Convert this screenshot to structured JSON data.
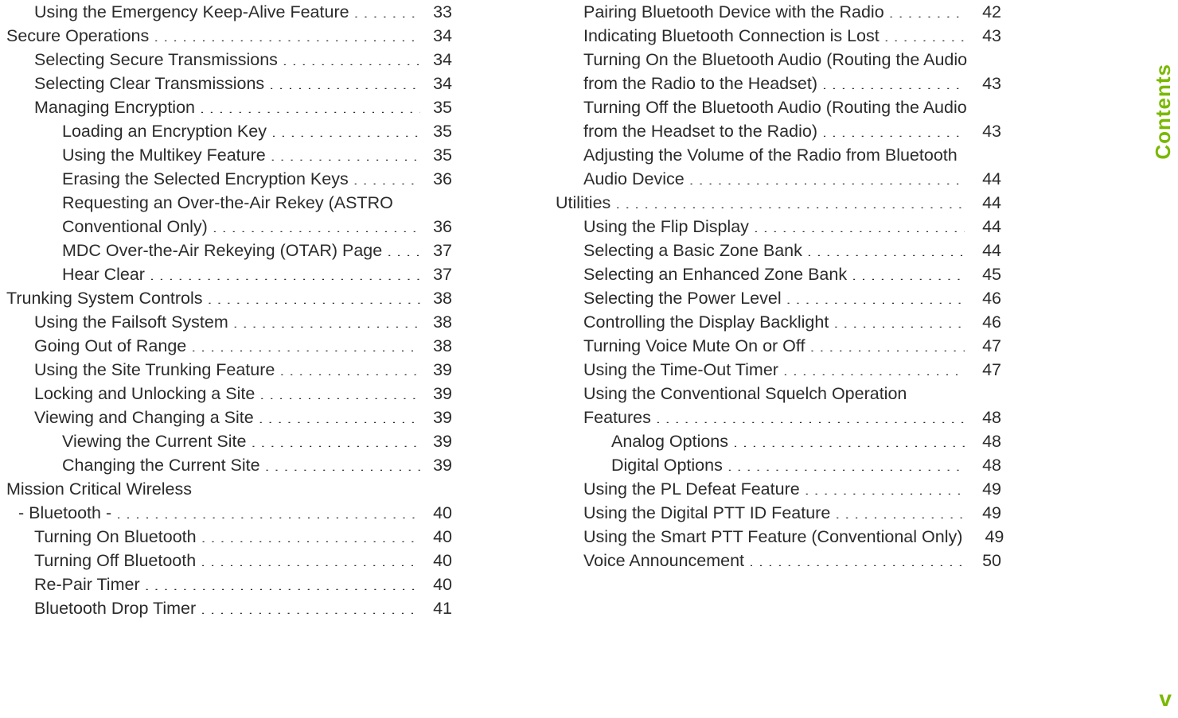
{
  "sideTab": {
    "label": "Contents"
  },
  "pageNumber": "v",
  "left": [
    {
      "kind": "entry",
      "level": 1,
      "title": "Using the Emergency Keep-Alive Feature",
      "page": "33"
    },
    {
      "kind": "entry",
      "level": 0,
      "title": "Secure Operations",
      "page": "34"
    },
    {
      "kind": "entry",
      "level": 1,
      "title": "Selecting Secure Transmissions",
      "page": "34"
    },
    {
      "kind": "entry",
      "level": 1,
      "title": "Selecting Clear Transmissions",
      "page": "34"
    },
    {
      "kind": "entry",
      "level": 1,
      "title": "Managing Encryption",
      "page": "35"
    },
    {
      "kind": "entry",
      "level": 2,
      "title": "Loading an Encryption Key",
      "page": "35"
    },
    {
      "kind": "entry",
      "level": 2,
      "title": "Using the Multikey Feature",
      "page": "35"
    },
    {
      "kind": "entry",
      "level": 2,
      "title": "Erasing the Selected Encryption Keys",
      "page": "36"
    },
    {
      "kind": "wrap",
      "level": 2,
      "title": "Requesting an Over-the-Air Rekey (ASTRO"
    },
    {
      "kind": "entry",
      "level": 2,
      "title": "Conventional Only)",
      "page": "36"
    },
    {
      "kind": "entry",
      "level": 2,
      "title": "MDC Over-the-Air Rekeying (OTAR) Page",
      "page": "37"
    },
    {
      "kind": "entry",
      "level": 2,
      "title": "Hear Clear",
      "page": "37"
    },
    {
      "kind": "entry",
      "level": 0,
      "title": "Trunking System Controls",
      "page": "38"
    },
    {
      "kind": "entry",
      "level": 1,
      "title": "Using the Failsoft System",
      "page": "38"
    },
    {
      "kind": "entry",
      "level": 1,
      "title": "Going Out of Range",
      "page": "38"
    },
    {
      "kind": "entry",
      "level": 1,
      "title": "Using the Site Trunking Feature",
      "page": "39"
    },
    {
      "kind": "entry",
      "level": 1,
      "title": "Locking and Unlocking a Site",
      "page": "39"
    },
    {
      "kind": "entry",
      "level": 1,
      "title": "Viewing and Changing a Site",
      "page": "39"
    },
    {
      "kind": "entry",
      "level": 2,
      "title": "Viewing the Current Site",
      "page": "39"
    },
    {
      "kind": "entry",
      "level": 2,
      "title": "Changing the Current Site",
      "page": "39"
    },
    {
      "kind": "wrap",
      "level": 0,
      "title": "Mission Critical Wireless"
    },
    {
      "kind": "entry",
      "level": 0,
      "title": " - Bluetooth -",
      "page": "40",
      "extraPad": "15px"
    },
    {
      "kind": "entry",
      "level": 1,
      "title": "Turning On Bluetooth",
      "page": "40"
    },
    {
      "kind": "entry",
      "level": 1,
      "title": "Turning Off Bluetooth",
      "page": "40"
    },
    {
      "kind": "entry",
      "level": 1,
      "title": "Re-Pair Timer",
      "page": "40"
    },
    {
      "kind": "entry",
      "level": 1,
      "title": "Bluetooth Drop Timer",
      "page": "41"
    }
  ],
  "right": [
    {
      "kind": "entry",
      "level": 1,
      "title": "Pairing Bluetooth Device with the Radio",
      "page": "42"
    },
    {
      "kind": "entry",
      "level": 1,
      "title": "Indicating Bluetooth Connection is Lost",
      "page": "43"
    },
    {
      "kind": "wrap",
      "level": 1,
      "title": "Turning On the Bluetooth Audio (Routing the Audio"
    },
    {
      "kind": "entry",
      "level": 1,
      "title": "from the Radio to the Headset)",
      "page": "43"
    },
    {
      "kind": "wrap",
      "level": 1,
      "title": "Turning Off the Bluetooth Audio (Routing the Audio"
    },
    {
      "kind": "entry",
      "level": 1,
      "title": "from the Headset to the Radio)",
      "page": "43"
    },
    {
      "kind": "wrap",
      "level": 1,
      "title": "Adjusting the Volume of the Radio from Bluetooth"
    },
    {
      "kind": "entry",
      "level": 1,
      "title": "Audio Device",
      "page": "44"
    },
    {
      "kind": "entry",
      "level": 0,
      "title": "Utilities",
      "page": "44"
    },
    {
      "kind": "entry",
      "level": 1,
      "title": "Using the Flip Display",
      "page": "44"
    },
    {
      "kind": "entry",
      "level": 1,
      "title": "Selecting a Basic Zone Bank",
      "page": "44"
    },
    {
      "kind": "entry",
      "level": 1,
      "title": "Selecting an Enhanced Zone Bank",
      "page": "45"
    },
    {
      "kind": "entry",
      "level": 1,
      "title": "Selecting the Power Level",
      "page": "46"
    },
    {
      "kind": "entry",
      "level": 1,
      "title": "Controlling the Display Backlight",
      "page": "46"
    },
    {
      "kind": "entry",
      "level": 1,
      "title": "Turning Voice Mute On or Off",
      "page": "47"
    },
    {
      "kind": "entry",
      "level": 1,
      "title": "Using the Time-Out Timer",
      "page": "47"
    },
    {
      "kind": "wrap",
      "level": 1,
      "title": "Using the Conventional Squelch Operation"
    },
    {
      "kind": "entry",
      "level": 1,
      "title": "Features",
      "page": "48"
    },
    {
      "kind": "entry",
      "level": 2,
      "title": "Analog Options",
      "page": "48"
    },
    {
      "kind": "entry",
      "level": 2,
      "title": "Digital Options",
      "page": "48"
    },
    {
      "kind": "entry",
      "level": 1,
      "title": "Using the PL Defeat Feature",
      "page": "49"
    },
    {
      "kind": "entry",
      "level": 1,
      "title": "Using the Digital PTT ID Feature",
      "page": "49"
    },
    {
      "kind": "entry",
      "level": 1,
      "title": "Using the Smart PTT Feature (Conventional Only)",
      "page": "49"
    },
    {
      "kind": "entry",
      "level": 1,
      "title": "Voice Announcement",
      "page": "50"
    }
  ]
}
